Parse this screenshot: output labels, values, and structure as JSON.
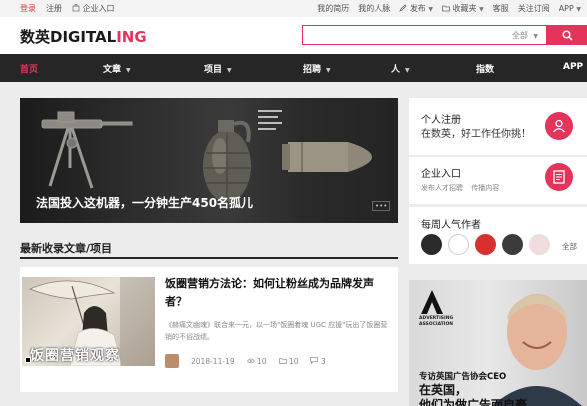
{
  "topbar": {
    "left": [
      "登录",
      "注册",
      "企业入口"
    ],
    "right": [
      "我的简历",
      "我的人脉",
      "发布",
      "收藏夹",
      "客服",
      "关注订阅",
      "APP"
    ]
  },
  "header": {
    "logo_cn": "数英",
    "logo_digital": "DIGITAL",
    "logo_ing": "ING",
    "search_placeholder": "",
    "search_scope": "全部"
  },
  "nav": {
    "items": [
      "首页",
      "文章",
      "项目",
      "招聘",
      "人",
      "指数",
      "APP"
    ]
  },
  "hero": {
    "caption": "法国投入这机器，一分钟生产450名孤儿"
  },
  "section": {
    "title": "最新收录文章/项目"
  },
  "article": {
    "thumb_caption": "饭圈营销观察",
    "title": "饭圈营销方法论：如何让粉丝成为品牌发声者？",
    "desc": "《赫痛文幽魂》联合来一元，以一场\"饭圈着魂 UGC 应援\"玩出了饭圈营销的不俗战绩。",
    "date": "2018-11-19",
    "views": "10",
    "favorites": "10",
    "comments": "3"
  },
  "right": {
    "register_title": "个人注册",
    "register_sub": "在数英，好工作任你挑！",
    "enterprise_title": "企业入口",
    "enterprise_links": [
      "发布人才招聘",
      "传播内容"
    ],
    "authors_title": "每周人气作者",
    "authors_all": "全部"
  },
  "ad": {
    "org": "ADVERTISING ASSOCIATION",
    "caption1": "专访英国广告协会CEO",
    "caption2": "在英国，",
    "caption3": "他们为做广告而自豪"
  },
  "colors": {
    "accent": "#e6335c",
    "nav_bg": "#262626"
  }
}
